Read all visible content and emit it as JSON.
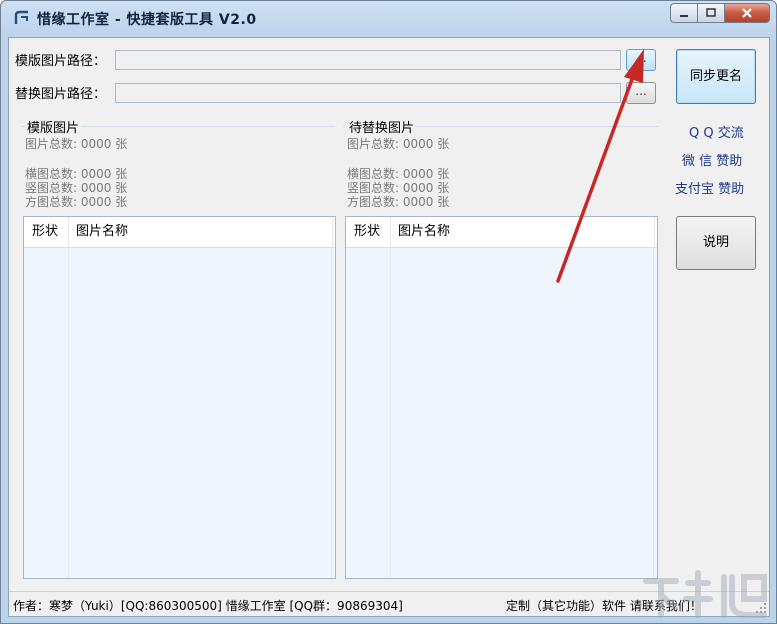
{
  "window": {
    "title": "惜缘工作室 - 快捷套版工具 V2.0",
    "caption_buttons": [
      "minimize",
      "maximize",
      "close"
    ]
  },
  "paths": {
    "template_label": "模版图片路径：",
    "template_value": "",
    "replace_label": "替换图片路径：",
    "replace_value": "",
    "browse_label": "..."
  },
  "template_group": {
    "title": "模版图片",
    "total": "图片总数: 0000 张",
    "landscape": "横图总数: 0000 张",
    "portrait": "竖图总数: 0000 张",
    "square": "方图总数: 0000 张",
    "col_shape": "形状",
    "col_name": "图片名称"
  },
  "replace_group": {
    "title": "待替换图片",
    "total": "图片总数: 0000 张",
    "landscape": "横图总数: 0000 张",
    "portrait": "竖图总数: 0000 张",
    "square": "方图总数: 0000 张",
    "col_shape": "形状",
    "col_name": "图片名称"
  },
  "sidebar": {
    "sync_rename": "同步更名",
    "qq_exchange": "Q Q 交流",
    "wechat_donate": "微 信 赞助",
    "alipay_donate": "支付宝 赞助",
    "help": "说明"
  },
  "status": {
    "author": "作者：寒梦（Yuki）[QQ:860300500]  惜缘工作室 [QQ群：90869304]",
    "custom": "定制（其它功能）软件 请联系我们！"
  },
  "colors": {
    "title_bg": "#bcd3ec",
    "client_bg": "#f0f0f0",
    "list_bg": "#eef5fc",
    "link": "#1f3a8a",
    "arrow": "#c62828",
    "close_btn": "#c65b44"
  }
}
